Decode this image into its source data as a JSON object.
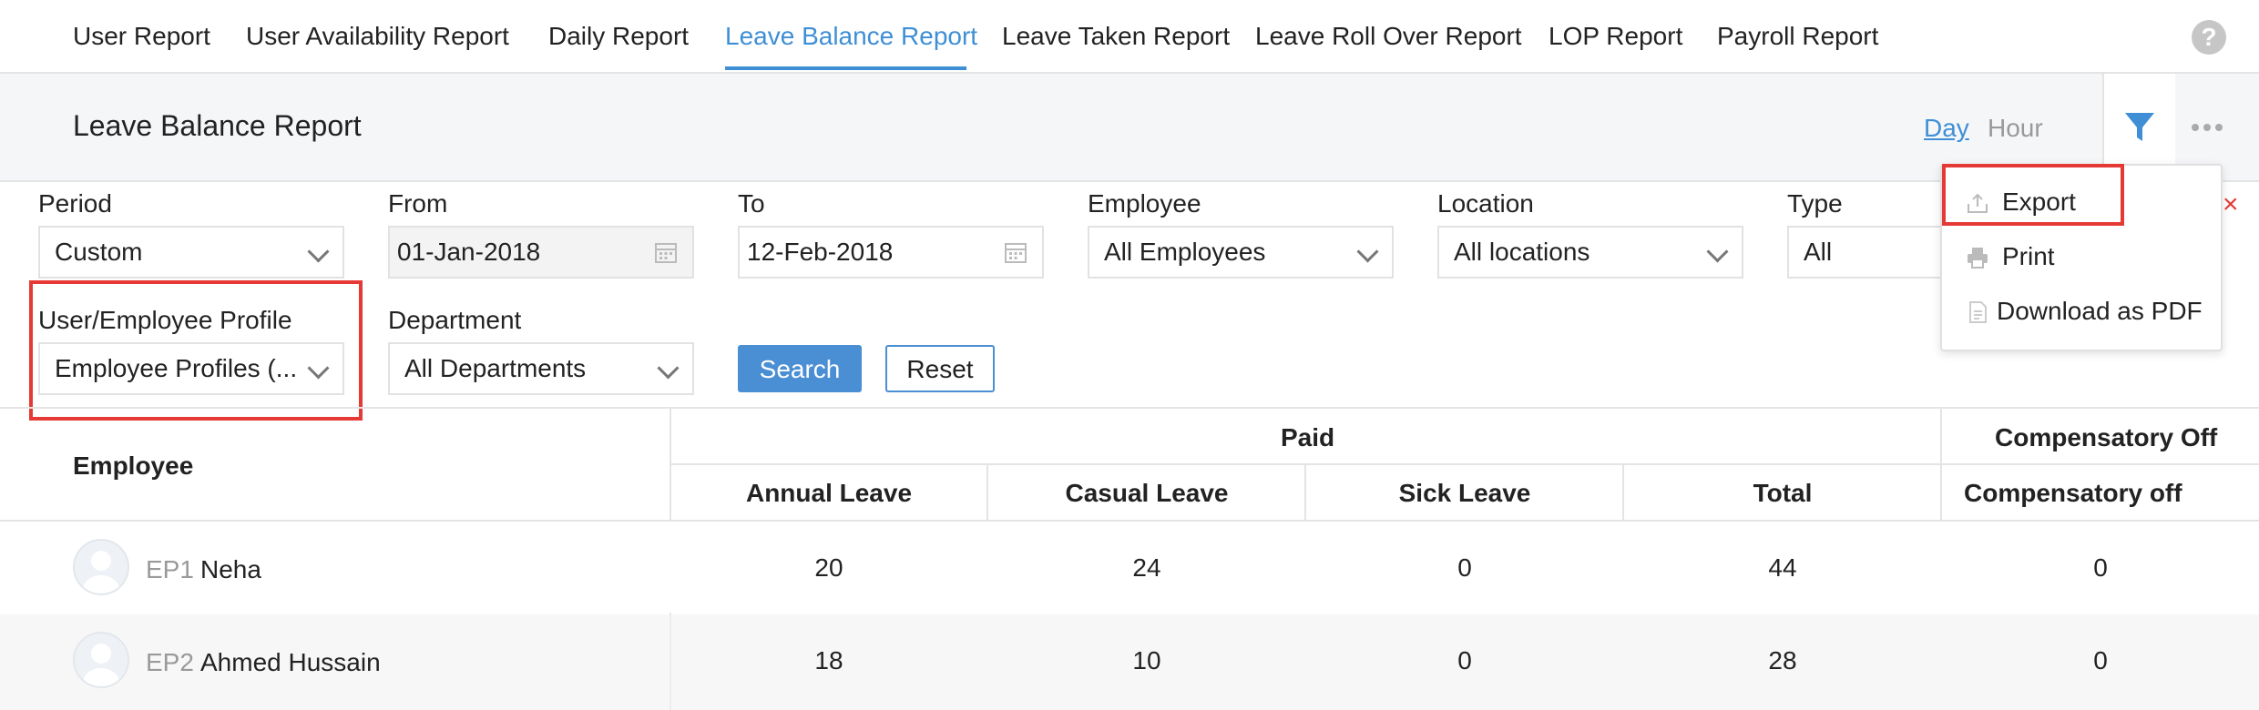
{
  "nav": {
    "tabs": [
      {
        "label": "User Report"
      },
      {
        "label": "User Availability Report"
      },
      {
        "label": "Daily Report"
      },
      {
        "label": "Leave Balance Report"
      },
      {
        "label": "Leave Taken Report"
      },
      {
        "label": "Leave Roll Over Report"
      },
      {
        "label": "LOP Report"
      },
      {
        "label": "Payroll Report"
      }
    ],
    "active_tab": "Leave Balance Report",
    "help_label": "?"
  },
  "header": {
    "title": "Leave Balance Report",
    "view_day": "Day",
    "view_hour": "Hour",
    "selected_view": "Day"
  },
  "filters": {
    "period": {
      "label": "Period",
      "value": "Custom"
    },
    "from": {
      "label": "From",
      "value": "01-Jan-2018"
    },
    "to": {
      "label": "To",
      "value": "12-Feb-2018"
    },
    "employee": {
      "label": "Employee",
      "value": "All Employees"
    },
    "location": {
      "label": "Location",
      "value": "All locations"
    },
    "type": {
      "label": "Type",
      "value": "All"
    },
    "profile": {
      "label": "User/Employee Profile",
      "value": "Employee Profiles (..."
    },
    "department": {
      "label": "Department",
      "value": "All Departments"
    },
    "search_label": "Search",
    "reset_label": "Reset"
  },
  "menu": {
    "items": [
      {
        "label": "Export",
        "icon": "upload-icon"
      },
      {
        "label": "Print",
        "icon": "printer-icon"
      },
      {
        "label": "Download as PDF",
        "icon": "pdf-icon"
      }
    ],
    "close_label": "×"
  },
  "table": {
    "employee_header": "Employee",
    "group_paid": "Paid",
    "group_comp": "Compensatory Off",
    "columns": [
      "Annual Leave",
      "Casual Leave",
      "Sick Leave",
      "Total",
      "Compensatory off"
    ],
    "rows": [
      {
        "code": "EP1",
        "name": "Neha",
        "values": [
          "20",
          "24",
          "0",
          "44",
          "0"
        ]
      },
      {
        "code": "EP2",
        "name": "Ahmed Hussain",
        "values": [
          "18",
          "10",
          "0",
          "28",
          "0"
        ]
      }
    ]
  },
  "colors": {
    "accent": "#3f8fd6",
    "button": "#4a8ed4",
    "highlight": "#e53935",
    "header_bg": "#f5f6f8"
  }
}
